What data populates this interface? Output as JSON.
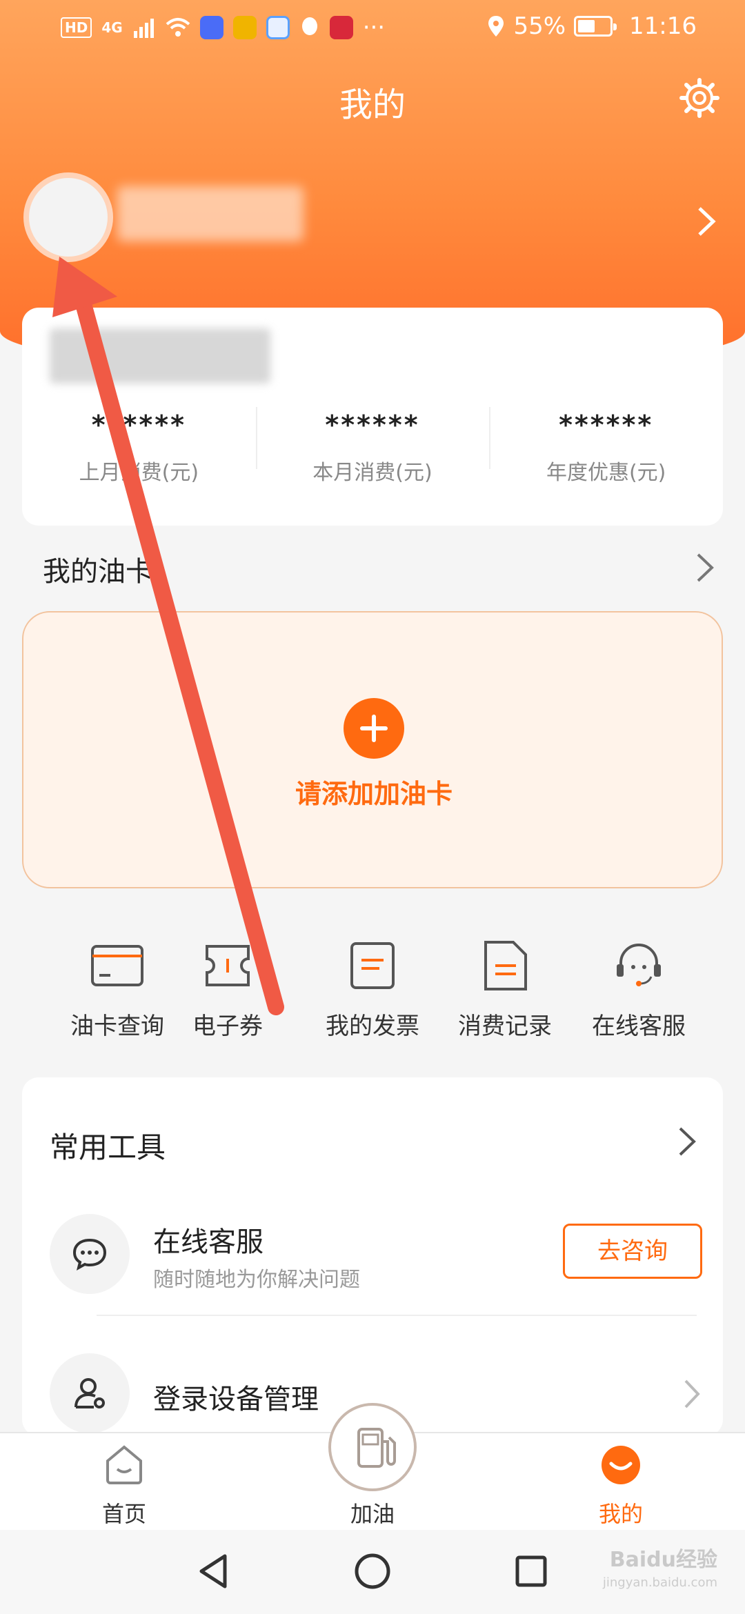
{
  "status_bar": {
    "hd": "HD",
    "network": "4G",
    "battery_text": "55%",
    "battery_level": 0.55,
    "time": "11:16",
    "more": "···"
  },
  "header": {
    "title": "我的"
  },
  "stats": [
    {
      "value": "******",
      "label": "上月消费(元)"
    },
    {
      "value": "******",
      "label": "本月消费(元)"
    },
    {
      "value": "******",
      "label": "年度优惠(元)"
    }
  ],
  "oil_card": {
    "section_title": "我的油卡",
    "add_label": "请添加加油卡"
  },
  "quick_actions": [
    {
      "label": "油卡查询",
      "icon": "card-icon"
    },
    {
      "label": "电子券",
      "icon": "ticket-icon"
    },
    {
      "label": "我的发票",
      "icon": "invoice-icon"
    },
    {
      "label": "消费记录",
      "icon": "record-icon"
    },
    {
      "label": "在线客服",
      "icon": "headset-icon"
    }
  ],
  "tools": {
    "title": "常用工具",
    "items": [
      {
        "name": "在线客服",
        "desc": "随时随地为你解决问题",
        "button": "去咨询",
        "icon": "chat-icon"
      },
      {
        "name": "登录设备管理",
        "icon": "user-device-icon"
      }
    ]
  },
  "bottom_nav": {
    "items": [
      {
        "label": "首页",
        "icon": "home-icon"
      },
      {
        "label": "加油",
        "icon": "fuel-pump-icon"
      },
      {
        "label": "我的",
        "icon": "smile-icon"
      }
    ],
    "accent": "#ff6a10"
  },
  "watermark": {
    "text": "Baidu经验",
    "sub": "jingyan.baidu.com"
  },
  "colors": {
    "accent": "#ff6a10",
    "header_gradient_top": "#ffa55c",
    "header_gradient_bottom": "#ff6d2a",
    "annotation_arrow": "#f05a45"
  }
}
